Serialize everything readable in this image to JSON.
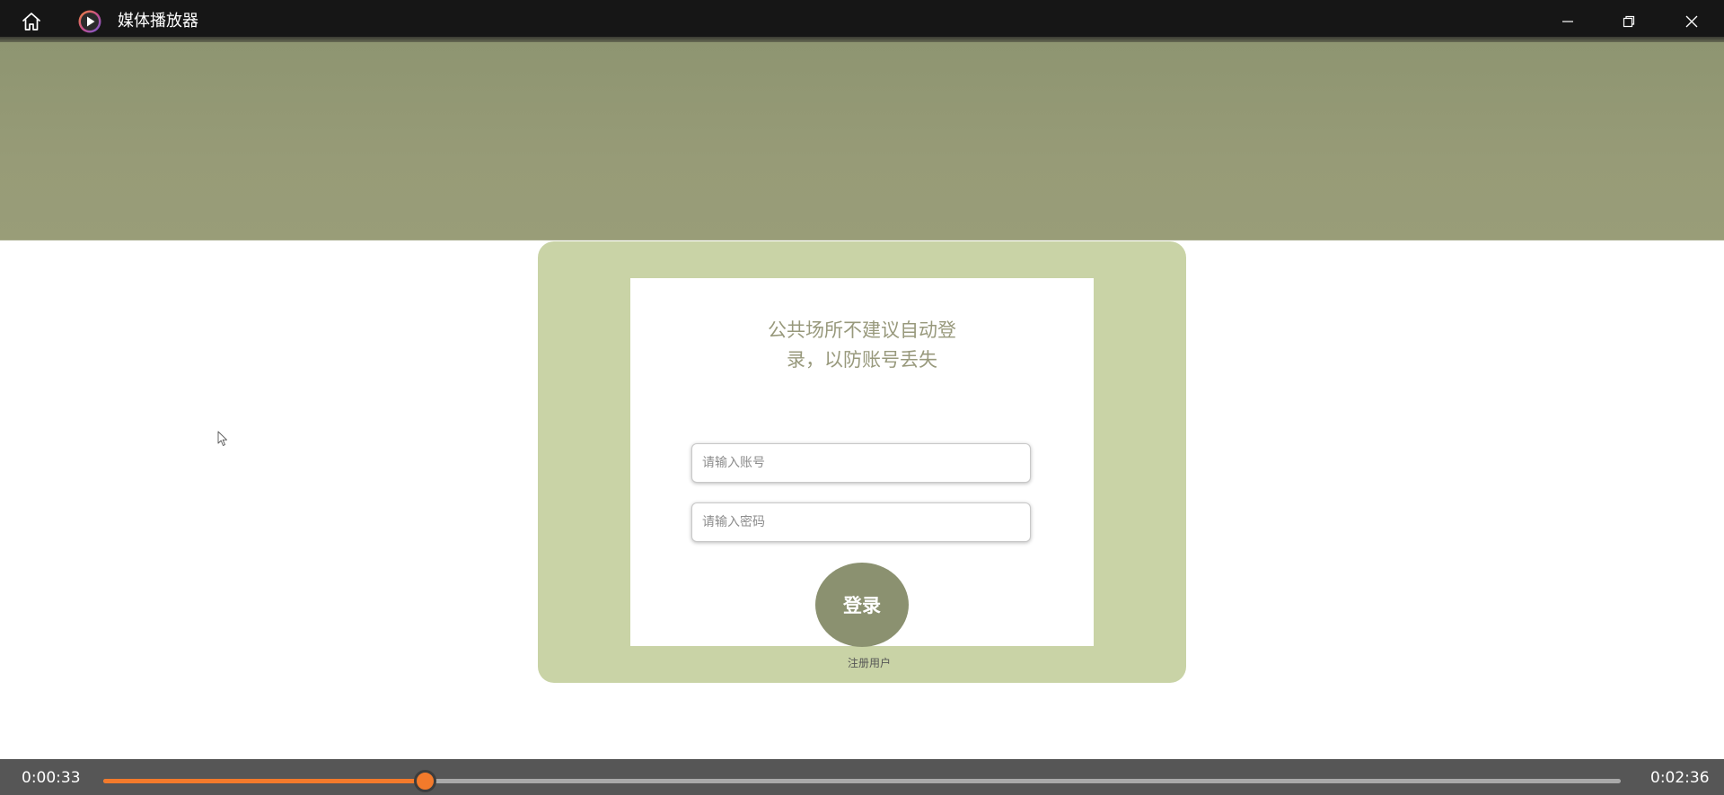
{
  "window": {
    "title": "媒体播放器",
    "home_icon": "home-icon",
    "app_icon": "media-player-icon",
    "controls": [
      "minimize-icon",
      "restore-icon",
      "close-icon"
    ]
  },
  "login": {
    "hint_line1": "公共场所不建议自动登",
    "hint_line2": "录，以防账号丢失",
    "account_placeholder": "请输入账号",
    "password_placeholder": "请输入密码",
    "login_label": "登录",
    "register_label": "注册用户"
  },
  "playback": {
    "current_time": "0:00:33",
    "total_time": "0:02:36",
    "progress": 0.212
  },
  "colors": {
    "accent": "#f37a2b",
    "banner": "#979b77",
    "card_outer": "#c9d3a6",
    "login_button": "#8b9170"
  }
}
